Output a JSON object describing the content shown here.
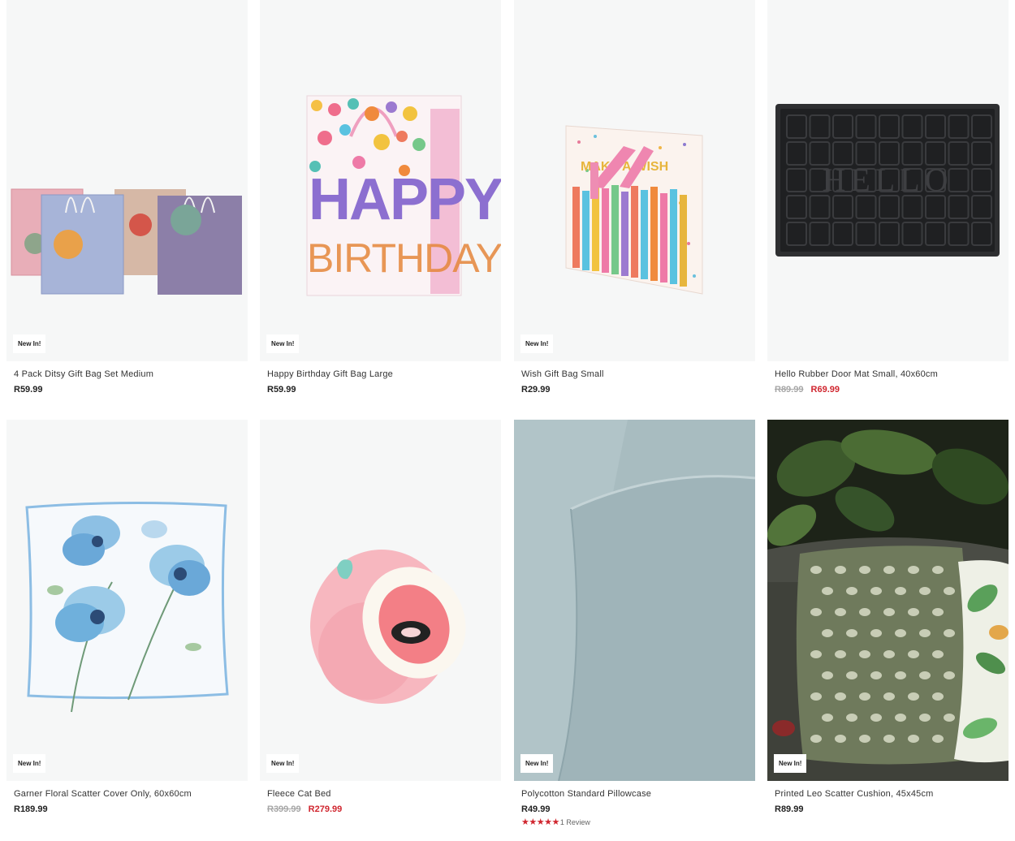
{
  "products": [
    {
      "badge": "New In!",
      "title": "4 Pack Ditsy Gift Bag Set Medium",
      "price": "R59.99"
    },
    {
      "badge": "New In!",
      "title": "Happy Birthday Gift Bag Large",
      "price": "R59.99",
      "art": {
        "line1": "HAPPY",
        "line2": "BIRTHDAY"
      }
    },
    {
      "badge": "New In!",
      "title": "Wish Gift Bag Small",
      "price": "R29.99",
      "art": {
        "line1": "MAKE A WISH"
      }
    },
    {
      "title": "Hello Rubber Door Mat Small, 40x60cm",
      "was_price": "R89.99",
      "sale_price": "R69.99",
      "art": {
        "line1": "HELLO"
      }
    },
    {
      "badge": "New In!",
      "title": "Garner Floral Scatter Cover Only, 60x60cm",
      "price": "R189.99"
    },
    {
      "badge": "New In!",
      "title": "Fleece Cat Bed",
      "was_price": "R399.99",
      "sale_price": "R279.99"
    },
    {
      "badge": "New In!",
      "title": "Polycotton Standard Pillowcase",
      "price": "R49.99",
      "rating": {
        "stars": 5,
        "review_text": "1 Review"
      }
    },
    {
      "badge": "New In!",
      "title": "Printed Leo Scatter Cushion, 45x45cm",
      "price": "R89.99"
    }
  ],
  "colors": {
    "sale": "#d0262f",
    "was": "#a7a7a7",
    "tile_bg": "#f6f7f7"
  }
}
